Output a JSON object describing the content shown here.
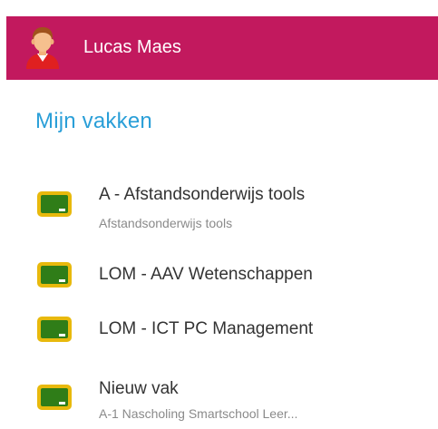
{
  "header": {
    "user_name": "Lucas Maes",
    "avatar_icon": "user-avatar-icon",
    "background_color": "#c2195e"
  },
  "section": {
    "title": "Mijn vakken",
    "title_color": "#2a9fd8"
  },
  "courses": [
    {
      "title": "A - Afstandsonderwijs tools",
      "subtitle": "Afstandsonderwijs tools",
      "icon": "chalkboard-icon"
    },
    {
      "title": "LOM - AAV Wetenschappen",
      "subtitle": "",
      "icon": "chalkboard-icon"
    },
    {
      "title": "LOM - ICT PC Management",
      "subtitle": "",
      "icon": "chalkboard-icon"
    },
    {
      "title": "Nieuw vak",
      "subtitle": "A-1 Nascholing Smartschool Leer...",
      "icon": "chalkboard-icon"
    }
  ]
}
